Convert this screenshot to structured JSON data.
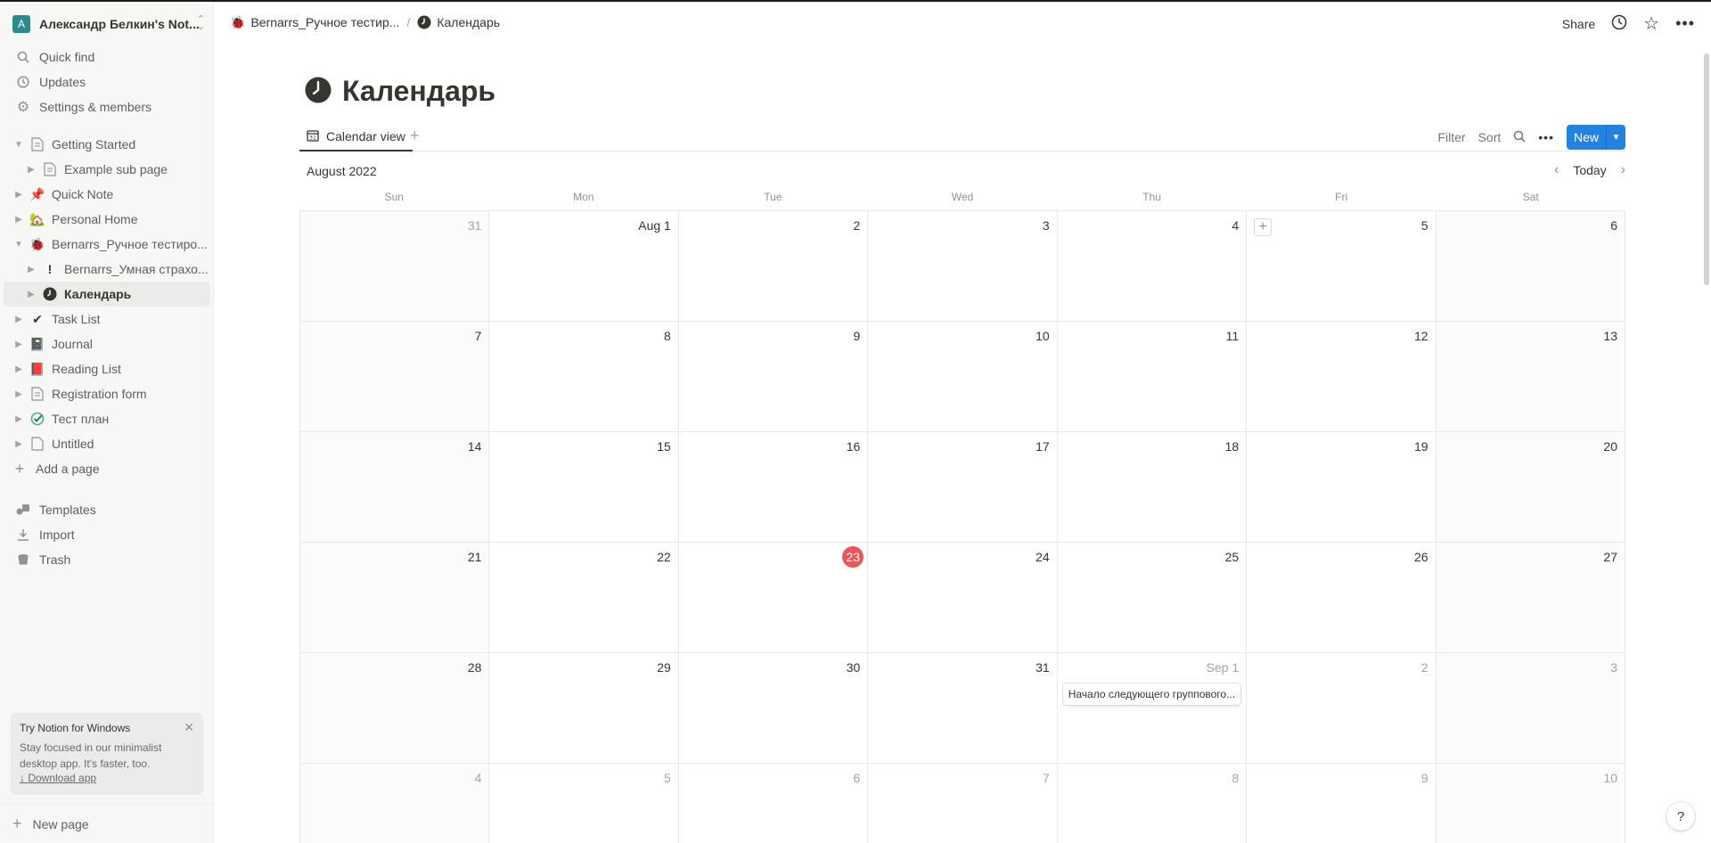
{
  "workspace": {
    "avatar_letter": "A",
    "name": "Александр Белкин's Not..."
  },
  "sidebar": {
    "top_items": [
      {
        "label": "Quick find",
        "icon": "search-icon"
      },
      {
        "label": "Updates",
        "icon": "clock-icon"
      },
      {
        "label": "Settings & members",
        "icon": "gear-icon"
      }
    ],
    "pages": [
      {
        "label": "Getting Started",
        "icon": "page-icon",
        "expanded": true
      },
      {
        "label": "Example sub page",
        "icon": "page-icon"
      },
      {
        "label": "Quick Note",
        "icon": "pushpin-icon"
      },
      {
        "label": "Personal Home",
        "icon": "house-icon"
      },
      {
        "label": "Bernarrs_Ручное тестиро...",
        "icon": "bug-icon",
        "expanded": true
      },
      {
        "label": "Bernarrs_Умная страхо...",
        "icon": "exclamation-icon"
      },
      {
        "label": "Календарь",
        "icon": "clock-icon",
        "active": true
      },
      {
        "label": "Task List",
        "icon": "checkmark-icon"
      },
      {
        "label": "Journal",
        "icon": "notebook-icon"
      },
      {
        "label": "Reading List",
        "icon": "book-icon"
      },
      {
        "label": "Registration form",
        "icon": "page-icon"
      },
      {
        "label": "Тест план",
        "icon": "check-circle-icon"
      },
      {
        "label": "Untitled",
        "icon": "page-icon"
      }
    ],
    "add_page": "Add a page",
    "bottom_items": [
      {
        "label": "Templates",
        "icon": "templates-icon"
      },
      {
        "label": "Import",
        "icon": "download-icon"
      },
      {
        "label": "Trash",
        "icon": "trash-icon"
      }
    ],
    "promo": {
      "title": "Try Notion for Windows",
      "text": "Stay focused in our minimalist desktop app. It's faster, too.",
      "link": "↓ Download app"
    },
    "new_page": "New page"
  },
  "topbar": {
    "breadcrumb": [
      {
        "label": "Bernarrs_Ручное тестир...",
        "icon": "bug-icon"
      },
      {
        "label": "Календарь",
        "icon": "clock-icon"
      }
    ],
    "share": "Share"
  },
  "page": {
    "title": "Календарь"
  },
  "view": {
    "tab_label": "Calendar view",
    "filter": "Filter",
    "sort": "Sort",
    "new_label": "New"
  },
  "calendar": {
    "month": "August 2022",
    "today_label": "Today",
    "weekdays": [
      "Sun",
      "Mon",
      "Tue",
      "Wed",
      "Thu",
      "Fri",
      "Sat"
    ],
    "days": [
      "31",
      "Aug 1",
      "2",
      "3",
      "4",
      "5",
      "6",
      "7",
      "8",
      "9",
      "10",
      "11",
      "12",
      "13",
      "14",
      "15",
      "16",
      "17",
      "18",
      "19",
      "20",
      "21",
      "22",
      "23",
      "24",
      "25",
      "26",
      "27",
      "28",
      "29",
      "30",
      "31",
      "Sep 1",
      "2",
      "3",
      "4",
      "5",
      "6",
      "7",
      "8",
      "9",
      "10"
    ],
    "today_index": 23,
    "event": {
      "day_index": 32,
      "title": "Начало следующего группового..."
    },
    "colors": {
      "today": "#eb5757",
      "accent": "#2383e2"
    }
  }
}
